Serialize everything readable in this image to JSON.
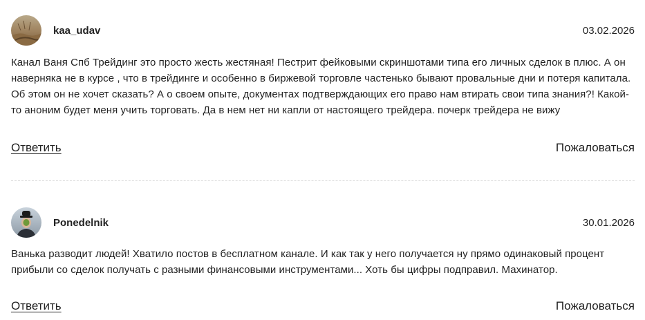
{
  "comments": [
    {
      "username": "kaa_udav",
      "date": "03.02.2026",
      "text": "Канал Ваня Спб Трейдинг это просто жесть жестяная! Пестрит фейковыми скриншотами типа его личных сделок в плюс. А он наверняка не в курсе , что в трейдинге и особенно в биржевой торговле частенько бывают провальные дни и потеря капитала. Об этом он не хочет сказать? А о своем опыте, документах подтверждающих его право нам втирать свои типа знания?! Какой-то аноним будет меня учить торговать. Да в нем нет ни капли от настоящего трейдера. почерк трейдера не вижу",
      "reply_label": "Ответить",
      "report_label": "Пожаловаться"
    },
    {
      "username": "Ponedelnik",
      "date": "30.01.2026",
      "text": "Ванька разводит людей! Хватило постов в бесплатном канале. И как так у него получается ну прямо одинаковый процент прибыли со сделок получать с разными финансовыми инструментами... Хоть бы цифры подправил. Махинатор.",
      "reply_label": "Ответить",
      "report_label": "Пожаловаться"
    }
  ],
  "colors": {
    "text": "#222222",
    "divider": "#dcdcdc"
  }
}
